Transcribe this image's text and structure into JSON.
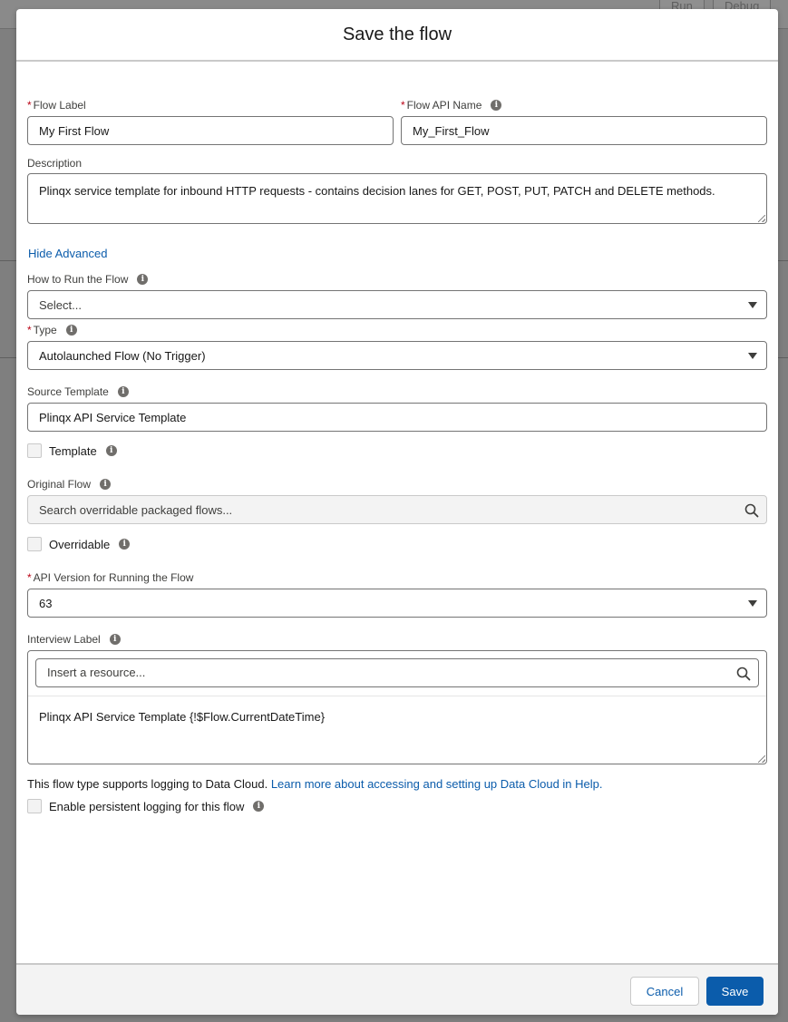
{
  "background": {
    "buttons": [
      "Run",
      "Debug"
    ]
  },
  "modal": {
    "title": "Save the flow"
  },
  "form": {
    "flow_label": {
      "label": "Flow Label",
      "value": "My First Flow"
    },
    "flow_api_name": {
      "label": "Flow API Name",
      "value": "My_First_Flow"
    },
    "description": {
      "label": "Description",
      "value": "Plinqx service template for inbound HTTP requests - contains decision lanes for GET, POST, PUT, PATCH and DELETE methods."
    },
    "hide_advanced": "Hide Advanced",
    "how_to_run": {
      "label": "How to Run the Flow",
      "value": "Select..."
    },
    "type": {
      "label": "Type",
      "value": "Autolaunched Flow (No Trigger)"
    },
    "source_template": {
      "label": "Source Template",
      "value": "Plinqx API Service Template"
    },
    "template_checkbox": {
      "label": "Template",
      "checked": false
    },
    "original_flow": {
      "label": "Original Flow",
      "placeholder": "Search overridable packaged flows..."
    },
    "overridable_checkbox": {
      "label": "Overridable",
      "checked": false
    },
    "api_version": {
      "label": "API Version for Running the Flow",
      "value": "63"
    },
    "interview_label": {
      "label": "Interview Label",
      "resource_placeholder": "Insert a resource...",
      "value": "Plinqx API Service Template {!$Flow.CurrentDateTime}"
    },
    "logging_note": "This flow type supports logging to Data Cloud.",
    "logging_link": "Learn more about accessing and setting up Data Cloud in Help.",
    "persistent_logging": {
      "label": "Enable persistent logging for this flow",
      "checked": false
    }
  },
  "footer": {
    "cancel_label": "Cancel",
    "save_label": "Save"
  },
  "colors": {
    "brand": "#0b5cab",
    "required": "#ba0517",
    "footer_bg": "#f3f3f3"
  }
}
